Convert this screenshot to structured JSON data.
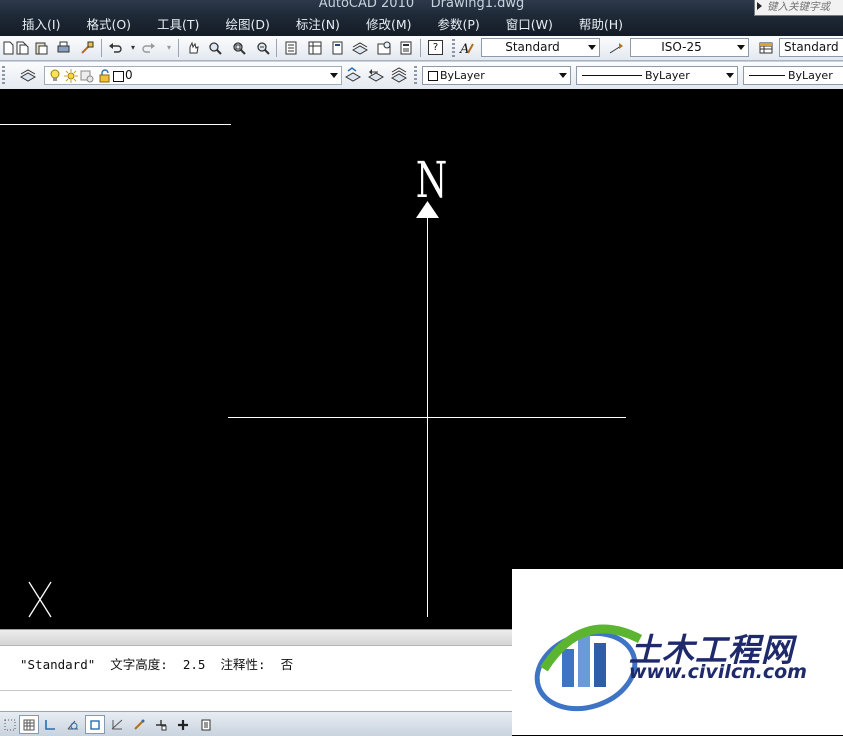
{
  "window": {
    "title": "AutoCAD 2010    Drawing1.dwg",
    "search_placeholder": "键入关键字或"
  },
  "menu": [
    "插入(I)",
    "格式(O)",
    "工具(T)",
    "绘图(D)",
    "标注(N)",
    "修改(M)",
    "参数(P)",
    "窗口(W)",
    "帮助(H)"
  ],
  "toolbar1": {
    "text_style": "Standard",
    "dim_style": "ISO-25",
    "table_style": "Standard"
  },
  "toolbar2": {
    "layer": "0",
    "color": "ByLayer",
    "linetype": "ByLayer",
    "lineweight": "ByLayer"
  },
  "canvas": {
    "background": "#000000",
    "north_label": "N"
  },
  "command": {
    "line": "\"Standard\"  文字高度:  2.5  注释性:  否"
  },
  "watermark": {
    "title": "土木工程网",
    "url": "www.civilcn.com"
  },
  "icons": {
    "toolbar1": [
      "new-icon",
      "open-icon",
      "paste-icon",
      "print-icon",
      "match-properties-icon",
      "undo-icon",
      "redo-icon",
      "pan-icon",
      "zoom-realtime-icon",
      "zoom-window-icon",
      "zoom-previous-icon",
      "properties-icon",
      "design-center-icon",
      "tool-palettes-icon",
      "sheet-set-icon",
      "markup-icon",
      "calculator-icon",
      "help-icon",
      "text-style-icon",
      "dim-style-icon",
      "table-style-icon"
    ],
    "toolbar2": [
      "layer-manager-icon",
      "lightbulb-icon",
      "sun-icon",
      "lock-icon",
      "make-current-icon",
      "layer-previous-icon",
      "layer-states-icon"
    ],
    "statusbar": [
      "snap-icon",
      "grid-icon",
      "ortho-icon",
      "polar-icon",
      "osnap-icon",
      "otrack-icon",
      "ducs-icon",
      "dyn-icon",
      "lineweight-icon",
      "qp-icon"
    ]
  },
  "colors": {
    "toolbar_accent": "#2b4a78",
    "watermark_blue": "#1f2a6b",
    "watermark_green": "#5bb531"
  }
}
